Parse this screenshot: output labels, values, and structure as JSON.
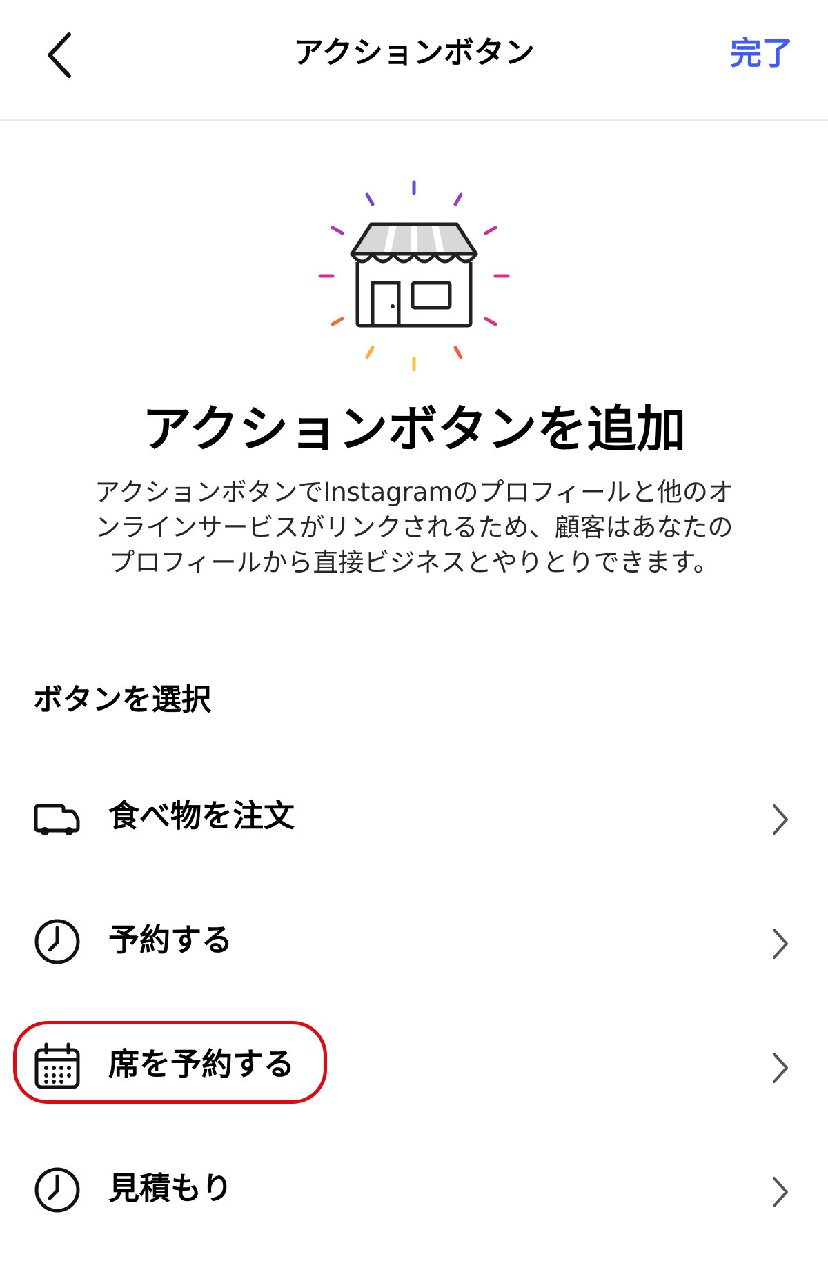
{
  "nav": {
    "title": "アクションボタン",
    "done_label": "完了",
    "done_color": "#3e5bf6",
    "back_icon": "chevron-left-icon"
  },
  "hero": {
    "icon": "storefront-icon",
    "title": "アクションボタンを追加",
    "description_lines": [
      "アクションボタンでInstagramのプロフィールと他のオ",
      "ンラインサービスがリンクされるため、顧客はあなたの",
      "プロフィールから直接ビジネスとやりとりできます。"
    ]
  },
  "section": {
    "title": "ボタンを選択"
  },
  "options": [
    {
      "label": "食べ物を注文",
      "icon": "delivery-truck-icon"
    },
    {
      "label": "予約する",
      "icon": "clock-icon"
    },
    {
      "label": "席を予約する",
      "icon": "calendar-icon",
      "highlighted": true
    },
    {
      "label": "見積もり",
      "icon": "clock-icon"
    }
  ],
  "colors": {
    "highlight": "#e30613",
    "text": "#000000",
    "chevron": "#8e8e8e"
  }
}
